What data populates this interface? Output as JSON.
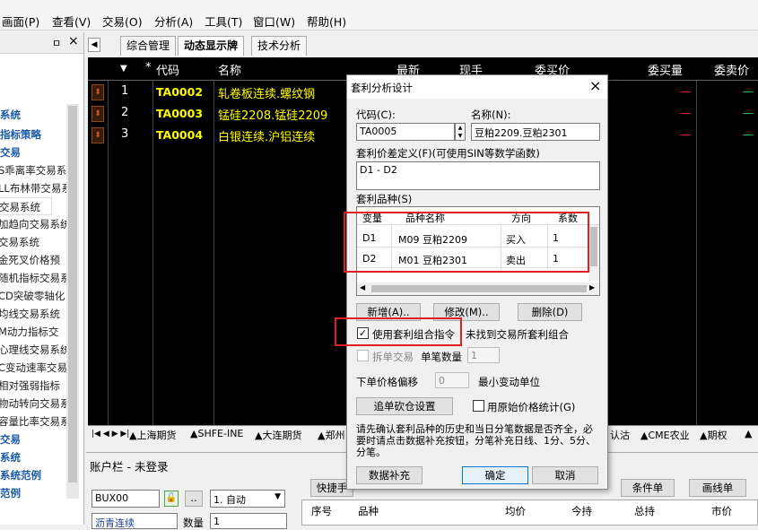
{
  "menu": [
    "画面(P)",
    "查看(V)",
    "交易(O)",
    "分析(A)",
    "工具(T)",
    "窗口(W)",
    "帮助(H)"
  ],
  "side_panel": {
    "pin": "ㅁ",
    "close": "×",
    "items": [
      {
        "label": "系统",
        "bold": true
      },
      {
        "label": "指标策略",
        "bold": true
      },
      {
        "label": "交易",
        "bold": true
      },
      {
        "label": "S乖离率交易系",
        "bold": false
      },
      {
        "label": "LL布林带交易系",
        "bold": false
      },
      {
        "label": "交易系统",
        "bold": false
      },
      {
        "label": "加趋向交易系统",
        "bold": false
      },
      {
        "label": "交易系统",
        "bold": false
      },
      {
        "label": "金死叉价格预",
        "bold": false
      },
      {
        "label": "随机指标交易系",
        "bold": false
      },
      {
        "label": "CD突破零轴化",
        "bold": false
      },
      {
        "label": "均线交易系统",
        "bold": false
      },
      {
        "label": "M动力指标交",
        "bold": false
      },
      {
        "label": "心理线交易系统",
        "bold": false
      },
      {
        "label": "C变动速率交易",
        "bold": false
      },
      {
        "label": "相对强弱指标",
        "bold": false
      },
      {
        "label": "物动转向交易系",
        "bold": false
      },
      {
        "label": "容量比率交易系",
        "bold": false
      },
      {
        "label": "交易",
        "bold": true
      },
      {
        "label": "系统",
        "bold": true
      },
      {
        "label": "系统范例",
        "bold": true
      },
      {
        "label": "范例",
        "bold": true
      }
    ]
  },
  "tabs": [
    "综合管理",
    "动态显示牌",
    "技术分析"
  ],
  "grid": {
    "headers": {
      "arrow": "▼",
      "star": "*",
      "code": "代码",
      "name": "名称",
      "latest": "最新",
      "volume": "现手",
      "bid_price": "委买价",
      "bid_vol": "委买量",
      "ask_price": "委卖价"
    },
    "rows": [
      {
        "idx": "1",
        "code": "TA0002",
        "name": "轧卷板连续.螺纹钢"
      },
      {
        "idx": "2",
        "code": "TA0003",
        "name": "锰硅2208.锰硅2209"
      },
      {
        "idx": "3",
        "code": "TA0004",
        "name": "白银连续.沪铝连续"
      }
    ],
    "dash": "—"
  },
  "bottom_tabs": [
    "▲上海期货",
    "▲SHFE-INE",
    "▲大连期货",
    "▲郑州",
    "认沽",
    "▲CME农业",
    "▲期权",
    "▲"
  ],
  "account": {
    "title": "账户栏 - 未登录",
    "account_id": "BUX00",
    "mode": "1. 自动",
    "contract": "沥青连续",
    "qty_label": "数量",
    "qty_value": "1",
    "buttons": [
      "快捷手",
      "条件单",
      "画线单"
    ],
    "table_headers": [
      "序号",
      "品种",
      "均价",
      "今持",
      "总持",
      "市价"
    ]
  },
  "dialog": {
    "title": "套利分析设计",
    "close": "×",
    "code_label": "代码(C):",
    "code_value": "TA0005",
    "name_label": "名称(N):",
    "name_value": "豆粕2209.豆粕2301",
    "formula_label": "套利价差定义(F)(可使用SIN等数学函数)",
    "formula_value": "D1 - D2",
    "species_label": "套利品种(S)",
    "species_headers": [
      "变量",
      "品种名称",
      "方向",
      "系数"
    ],
    "species_rows": [
      {
        "var": "D1",
        "name": "M09 豆粕2209",
        "dir": "买入",
        "coef": "1"
      },
      {
        "var": "D2",
        "name": "M01 豆粕2301",
        "dir": "卖出",
        "coef": "1"
      }
    ],
    "btn_add": "新增(A)..",
    "btn_edit": "修改(M)..",
    "btn_delete": "删除(D)",
    "use_combo_label": "使用套利组合指令",
    "use_combo_checked": "✓",
    "not_found": "未找到交易所套利组合",
    "split_label": "拆单交易",
    "per_lot_label": "单笔数量",
    "per_lot_value": "1",
    "offset_label": "下单价格偏移",
    "offset_value": "0",
    "offset_unit": "最小变动单位",
    "chase_btn": "追单砍仓设置",
    "orig_price_label": "用原始价格统计(G)",
    "note": "请先确认套利品种的历史和当日分笔数据是否齐全，必要时请点击数据补充按钮，分笔补充日线、1分、5分、分笔。",
    "btn_supplement": "数据补充",
    "btn_ok": "确定",
    "btn_cancel": "取消"
  }
}
